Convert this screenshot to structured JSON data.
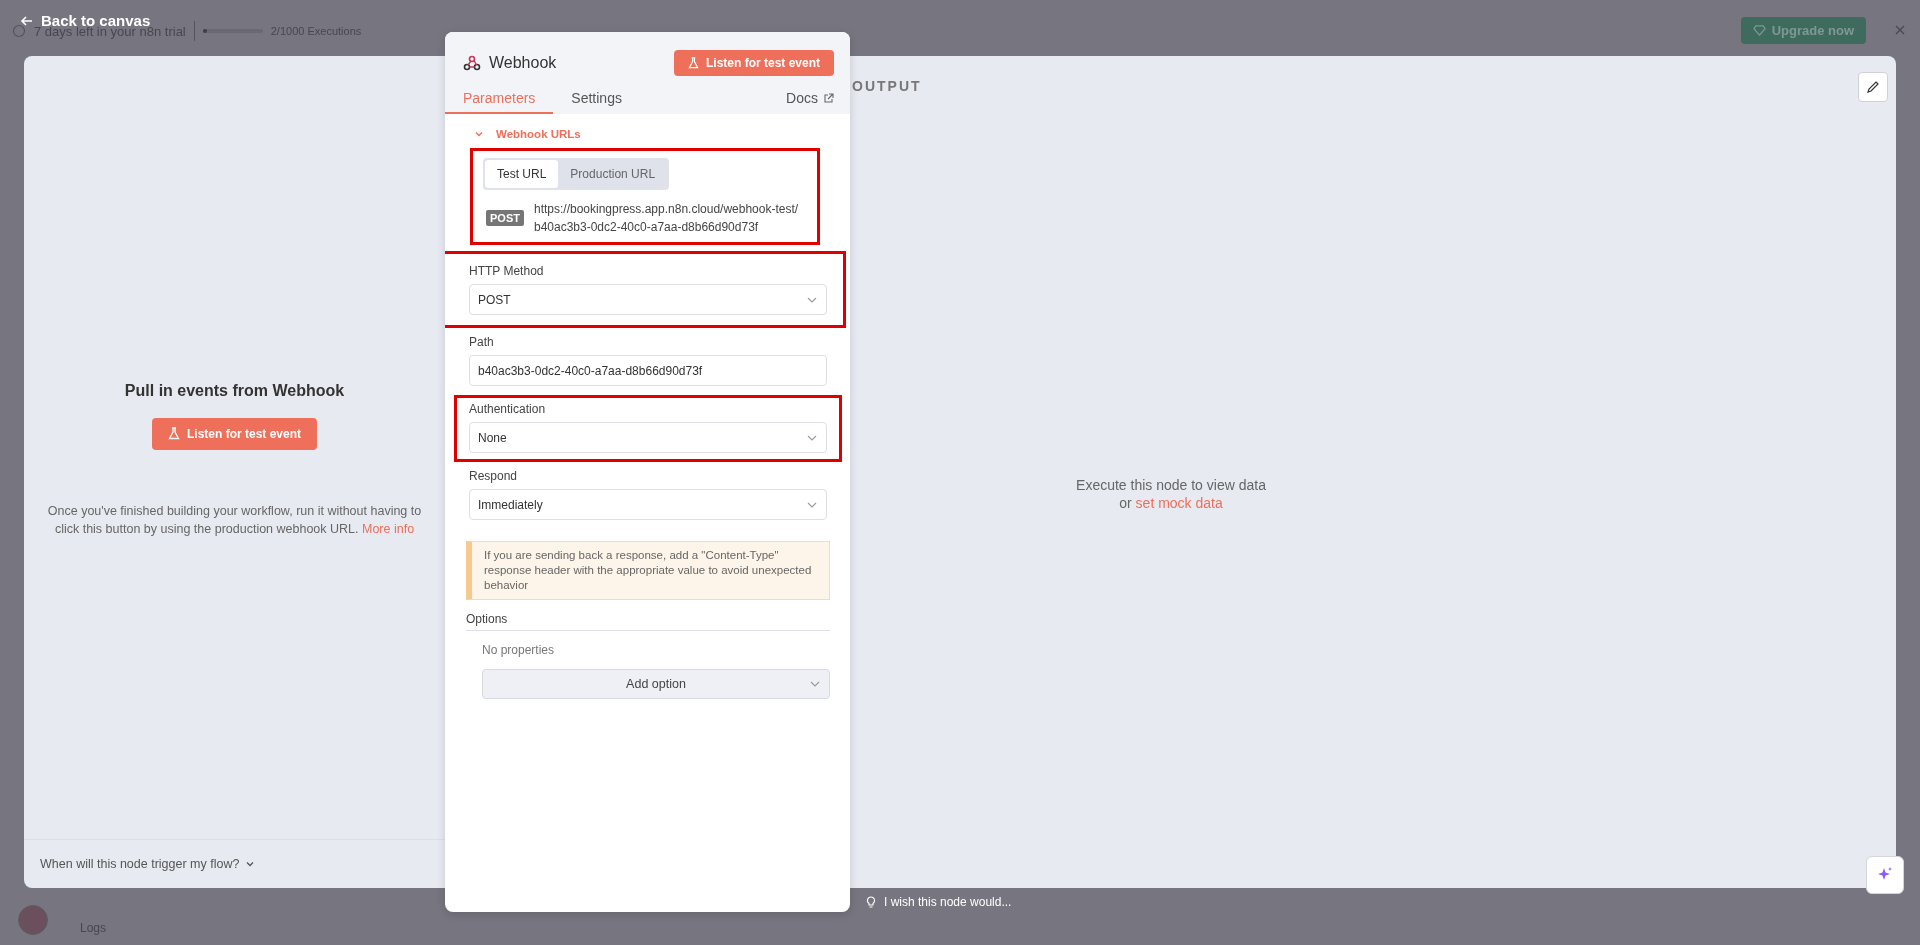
{
  "top_bar": {
    "back_link": "Back to canvas",
    "trial_text": "7 days left in your n8n trial",
    "executions": {
      "label": "2/1000 Executions",
      "level": 0.02
    },
    "upgrade_button": "Upgrade now"
  },
  "input_panel": {
    "title": "Pull in events from Webhook",
    "button": "Listen for test event",
    "description": "Once you've finished building your workflow, run it without having to click this button by using the production webhook URL.",
    "link": "More info",
    "footer": "When will this node trigger my flow?"
  },
  "node_panel": {
    "title": "Webhook",
    "button": "Listen for test event",
    "tabs": [
      {
        "label": "Parameters",
        "selected": true
      },
      {
        "label": "Settings",
        "selected": false
      }
    ],
    "docs": "Docs",
    "url_section": {
      "label": "Webhook URLs",
      "expanded": true,
      "highlighted": true,
      "url_tabs": [
        {
          "label": "Test URL",
          "selected": true
        },
        {
          "label": "Production URL",
          "selected": false
        }
      ],
      "method": "POST",
      "url": "https://bookingpress.app.n8n.cloud/webhook-test/b40ac3b3-0dc2-40c0-a7aa-d8b66d90d73f"
    },
    "fields": [
      {
        "kind": "select",
        "label": "HTTP Method",
        "value": "POST",
        "highlighted": true
      },
      {
        "kind": "input",
        "label": "Path",
        "value": "b40ac3b3-0dc2-40c0-a7aa-d8b66d90d73f",
        "highlighted": false
      },
      {
        "kind": "select",
        "label": "Authentication",
        "value": "None",
        "highlighted": true
      },
      {
        "kind": "select",
        "label": "Respond",
        "value": "Immediately",
        "highlighted": false
      }
    ],
    "notice": "If you are sending back a response, add a \"Content-Type\" response header with the appropriate value to avoid unexpected behavior",
    "options": {
      "label": "Options",
      "empty_text": "No properties",
      "button": "Add option"
    }
  },
  "output_panel": {
    "title": "OUTPUT",
    "message": "Execute this node to view data",
    "or": "or",
    "link": "set mock data"
  },
  "feedback": "I wish this node would...",
  "bottom_bar": {
    "logs": "Logs"
  }
}
